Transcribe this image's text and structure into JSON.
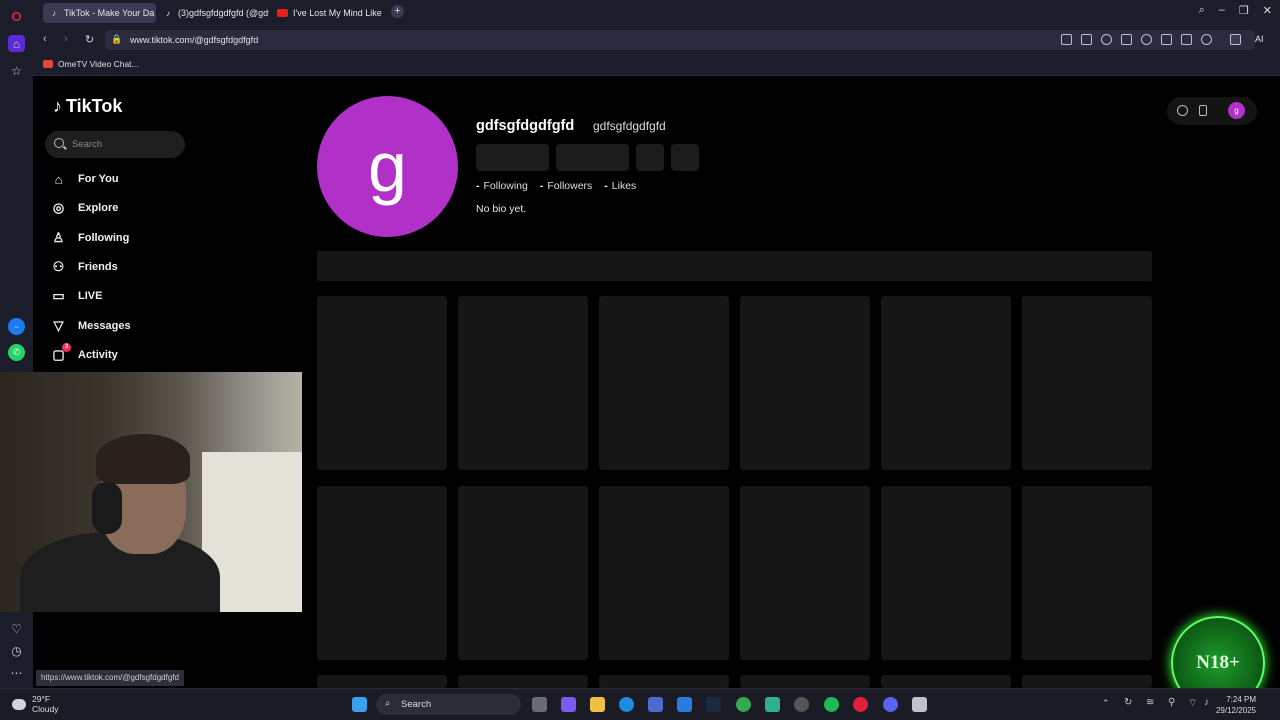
{
  "browser": {
    "tabs": [
      {
        "label": "TikTok - Make Your Da",
        "active": true
      },
      {
        "label": "(3)gdfsgfdgdfgfd (@gdfsg",
        "active": false
      },
      {
        "label": "I've Lost My Mind Like Vic",
        "active": false
      }
    ],
    "new_tab_label": "+",
    "url": "www.tiktok.com/@gdfsgfdgdfgfd",
    "bookmark": "OmeTV Video Chat...",
    "ai_label": "AI",
    "status_url": "https://www.tiktok.com/@gdfsgfdgdfgfd"
  },
  "tiktok": {
    "logo": "TikTok",
    "search_placeholder": "Search",
    "nav": [
      {
        "label": "For You",
        "icon": "home-icon"
      },
      {
        "label": "Explore",
        "icon": "compass-icon"
      },
      {
        "label": "Following",
        "icon": "user-follow-icon"
      },
      {
        "label": "Friends",
        "icon": "friends-icon"
      },
      {
        "label": "LIVE",
        "icon": "live-icon"
      },
      {
        "label": "Messages",
        "icon": "messages-icon"
      },
      {
        "label": "Activity",
        "icon": "activity-icon",
        "badge": "3"
      }
    ],
    "profile": {
      "avatar_letter": "g",
      "avatar_color": "#b030c8",
      "username": "gdfsgfdgdfgfd",
      "nickname": "gdfsgfdgdfgfd",
      "stats": [
        {
          "value": "-",
          "label": "Following"
        },
        {
          "value": "-",
          "label": "Followers"
        },
        {
          "value": "-",
          "label": "Likes"
        }
      ],
      "bio": "No bio yet."
    }
  },
  "overlay": {
    "badge": "N18+",
    "badge_color": "#1f9b2b"
  },
  "taskbar": {
    "weather_temp": "29°F",
    "weather_desc": "Cloudy",
    "search_label": "Search",
    "time": "7:24 PM",
    "date": "29/12/2025"
  }
}
